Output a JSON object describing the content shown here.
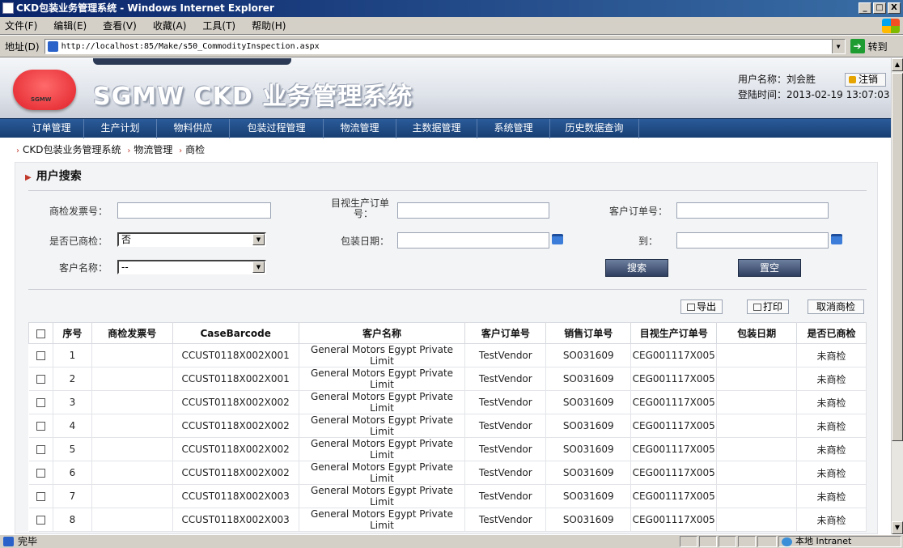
{
  "window": {
    "title": "CKD包装业务管理系统 - Windows Internet Explorer",
    "min": "_",
    "max": "□",
    "close": "X"
  },
  "menu": [
    "文件(F)",
    "编辑(E)",
    "查看(V)",
    "收藏(A)",
    "工具(T)",
    "帮助(H)"
  ],
  "address": {
    "label": "地址(D)",
    "url": "http://localhost:85/Make/s50_CommodityInspection.aspx",
    "go": "转到"
  },
  "header": {
    "brand": "SGMW CKD 业务管理系统",
    "logo_text": "SGMW",
    "user_label": "用户名称：",
    "user_name": "刘会胜",
    "login_label": "登陆时间：",
    "login_time": "2013-02-19 13:07:03",
    "logout": "注销"
  },
  "nav": [
    "订单管理",
    "生产计划",
    "物料供应",
    "包装过程管理",
    "物流管理",
    "主数据管理",
    "系统管理",
    "历史数据查询"
  ],
  "breadcrumb": [
    "CKD包装业务管理系统",
    "物流管理",
    "商检"
  ],
  "search": {
    "title": "用户搜索",
    "invoice_label": "商检发票号：",
    "prod_order_label_1": "目视生产订单",
    "prod_order_label_2": "号：",
    "customer_order_label": "客户订单号：",
    "inspected_label": "是否已商检：",
    "inspected_value": "否",
    "pack_date_label": "包装日期：",
    "to_label": "到：",
    "customer_name_label": "客户名称：",
    "customer_name_value": "--",
    "search_button": "搜索",
    "clear_button": "置空"
  },
  "actions": {
    "export": "导出",
    "print": "打印",
    "cancel": "取消商检"
  },
  "table": {
    "headers": [
      "序号",
      "商检发票号",
      "CaseBarcode",
      "客户名称",
      "客户订单号",
      "销售订单号",
      "目视生产订单号",
      "包装日期",
      "是否已商检"
    ],
    "rows": [
      {
        "no": "1",
        "invoice": "",
        "barcode": "CCUST0118X002X001",
        "customer": "General Motors Egypt Private Limit",
        "cust_order": "TestVendor",
        "sales_order": "SO031609",
        "prod_order": "CEG001117X005",
        "pack_date": "",
        "status": "未商检"
      },
      {
        "no": "2",
        "invoice": "",
        "barcode": "CCUST0118X002X001",
        "customer": "General Motors Egypt Private Limit",
        "cust_order": "TestVendor",
        "sales_order": "SO031609",
        "prod_order": "CEG001117X005",
        "pack_date": "",
        "status": "未商检"
      },
      {
        "no": "3",
        "invoice": "",
        "barcode": "CCUST0118X002X002",
        "customer": "General Motors Egypt Private Limit",
        "cust_order": "TestVendor",
        "sales_order": "SO031609",
        "prod_order": "CEG001117X005",
        "pack_date": "",
        "status": "未商检"
      },
      {
        "no": "4",
        "invoice": "",
        "barcode": "CCUST0118X002X002",
        "customer": "General Motors Egypt Private Limit",
        "cust_order": "TestVendor",
        "sales_order": "SO031609",
        "prod_order": "CEG001117X005",
        "pack_date": "",
        "status": "未商检"
      },
      {
        "no": "5",
        "invoice": "",
        "barcode": "CCUST0118X002X002",
        "customer": "General Motors Egypt Private Limit",
        "cust_order": "TestVendor",
        "sales_order": "SO031609",
        "prod_order": "CEG001117X005",
        "pack_date": "",
        "status": "未商检"
      },
      {
        "no": "6",
        "invoice": "",
        "barcode": "CCUST0118X002X002",
        "customer": "General Motors Egypt Private Limit",
        "cust_order": "TestVendor",
        "sales_order": "SO031609",
        "prod_order": "CEG001117X005",
        "pack_date": "",
        "status": "未商检"
      },
      {
        "no": "7",
        "invoice": "",
        "barcode": "CCUST0118X002X003",
        "customer": "General Motors Egypt Private Limit",
        "cust_order": "TestVendor",
        "sales_order": "SO031609",
        "prod_order": "CEG001117X005",
        "pack_date": "",
        "status": "未商检"
      },
      {
        "no": "8",
        "invoice": "",
        "barcode": "CCUST0118X002X003",
        "customer": "General Motors Egypt Private Limit",
        "cust_order": "TestVendor",
        "sales_order": "SO031609",
        "prod_order": "CEG001117X005",
        "pack_date": "",
        "status": "未商检"
      }
    ]
  },
  "status": {
    "text": "完毕",
    "zone": "本地 Intranet"
  }
}
